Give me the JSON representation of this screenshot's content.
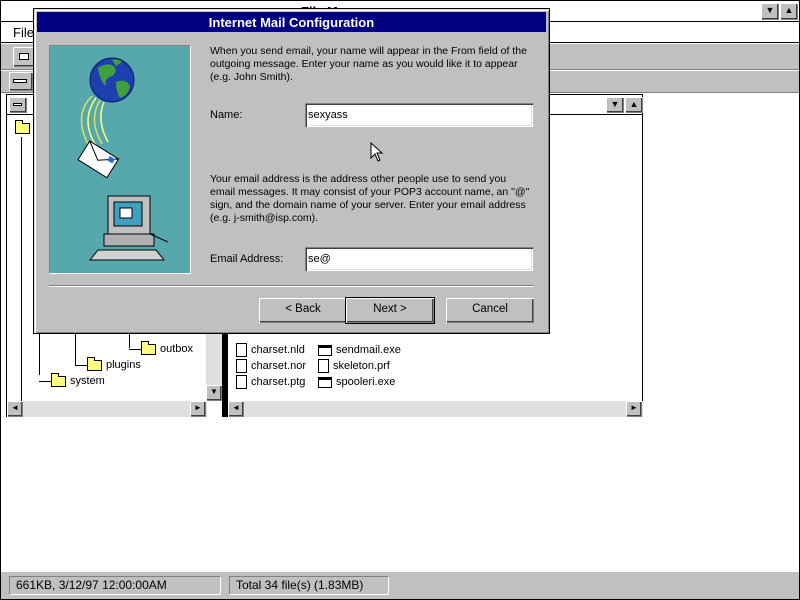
{
  "file_manager": {
    "title": "File Manager",
    "menu": {
      "file": "File"
    },
    "tree": {
      "items": [
        {
          "label": "outbox"
        },
        {
          "label": "plugins"
        },
        {
          "label": "system"
        }
      ]
    },
    "files": {
      "col1": [
        "charset.nld",
        "charset.nor",
        "charset.ptg"
      ],
      "col2": [
        "sendmail.exe",
        "skeleton.prf",
        "spooleri.exe"
      ]
    },
    "status": {
      "left": "661KB, 3/12/97 12:00:00AM",
      "right": "Total 34 file(s) (1.83MB)"
    }
  },
  "dialog": {
    "title": "Internet Mail Configuration",
    "intro_text": "When you send email, your name will appear in the From field of the outgoing message. Enter your name as you would like it to appear (e.g. John Smith).",
    "name_label": "Name:",
    "name_value": "sexyass",
    "email_text": "Your email address is the address other people use to send you email messages. It may consist of your POP3 account name, an \"@\" sign, and the domain name of your server. Enter your email address (e.g. j-smith@isp.com).",
    "email_label": "Email Address:",
    "email_value": "se@",
    "buttons": {
      "back": "< Back",
      "next": "Next >",
      "cancel": "Cancel"
    }
  }
}
